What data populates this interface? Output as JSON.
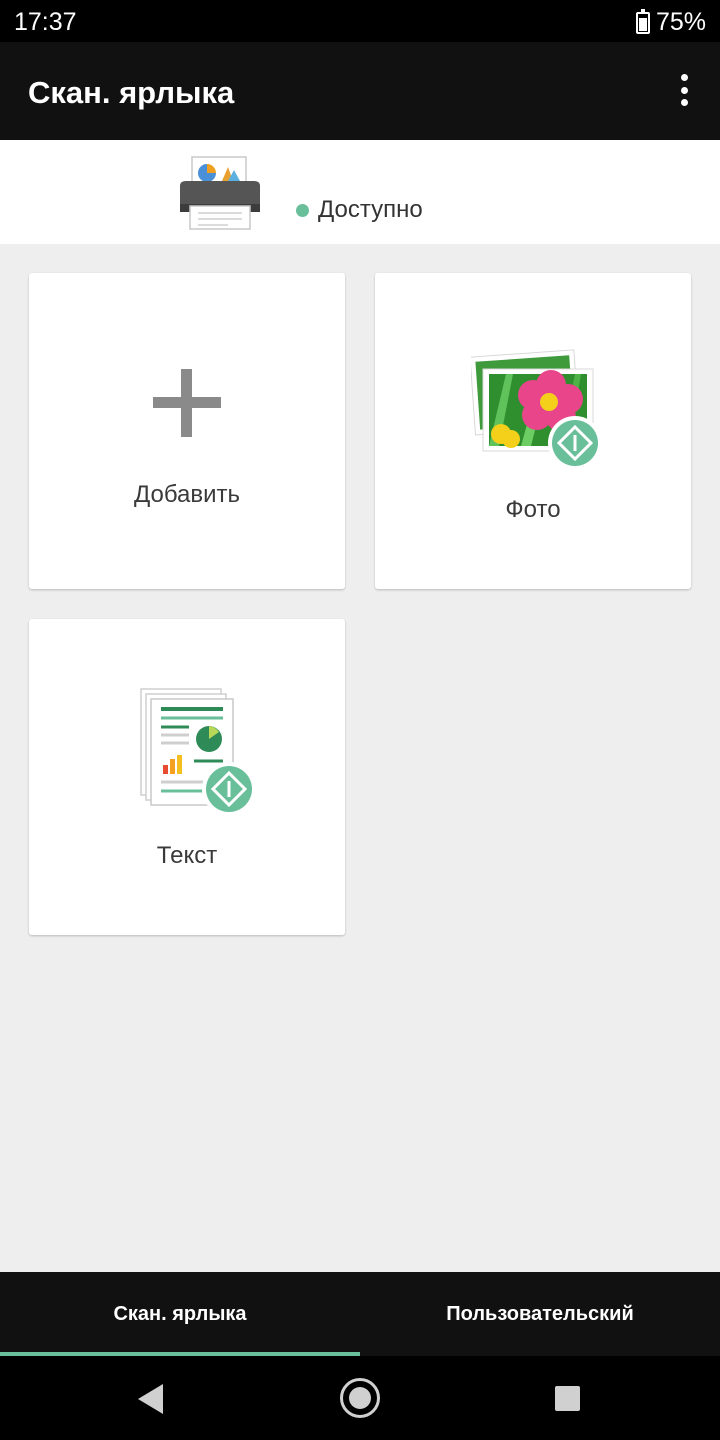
{
  "status_bar": {
    "time": "17:37",
    "battery": "75%"
  },
  "app_bar": {
    "title": "Скан. ярлыка"
  },
  "printer": {
    "status": "Доступно"
  },
  "tiles": {
    "add": {
      "label": "Добавить"
    },
    "photo": {
      "label": "Фото"
    },
    "text": {
      "label": "Текст"
    }
  },
  "bottom_nav": {
    "tabs": [
      {
        "label": "Скан. ярлыка",
        "selected": true
      },
      {
        "label": "Пользовательский",
        "selected": false
      }
    ]
  },
  "colors": {
    "accent": "#6abf9b",
    "app_bar": "#111111",
    "background": "#efeeef"
  },
  "icons": [
    "overflow-menu-icon",
    "printer-icon",
    "plus-icon",
    "photo-scan-icon",
    "document-scan-icon"
  ]
}
